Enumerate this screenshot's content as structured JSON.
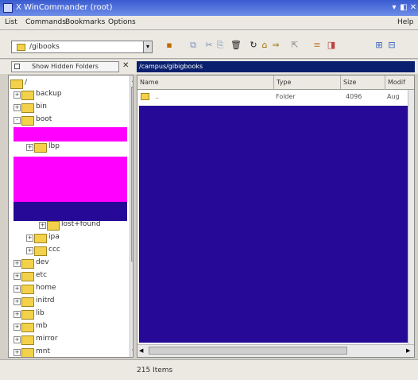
{
  "window": {
    "title": "X WinCommander (root)",
    "help": "Help",
    "controls": [
      "▾",
      "◧",
      "✕"
    ]
  },
  "menubar": {
    "items": [
      "List",
      "Commands",
      "Bookmarks",
      "Options"
    ]
  },
  "toolbar": {
    "path_combo": "/gibooks",
    "combo_arrow": "▾",
    "icons": [
      "▪",
      "⧉",
      "✂",
      "⎘",
      "🗑",
      "↻",
      "⌂",
      "⇒",
      "⇱",
      "≡",
      "◨",
      "⊞",
      "⊟"
    ]
  },
  "tree": {
    "show_hidden_label": "Show Hidden Folders",
    "close": "✕",
    "items": [
      {
        "label": "/",
        "indent": 0,
        "expander": ""
      },
      {
        "label": "backup",
        "indent": 1,
        "expander": "+"
      },
      {
        "label": "bin",
        "indent": 1,
        "expander": "+"
      },
      {
        "label": "boot",
        "indent": 1,
        "expander": "-"
      },
      {
        "label": "",
        "indent": 2,
        "expander": ""
      },
      {
        "label": "lbp",
        "indent": 2,
        "expander": "+"
      },
      {
        "label": "lost+found",
        "indent": 3,
        "expander": "+"
      },
      {
        "label": "ipa",
        "indent": 2,
        "expander": "+"
      },
      {
        "label": "ccc",
        "indent": 2,
        "expander": "+"
      },
      {
        "label": "dev",
        "indent": 1,
        "expander": "+"
      },
      {
        "label": "etc",
        "indent": 1,
        "expander": "+"
      },
      {
        "label": "home",
        "indent": 1,
        "expander": "+"
      },
      {
        "label": "initrd",
        "indent": 1,
        "expander": "+"
      },
      {
        "label": "lib",
        "indent": 1,
        "expander": "+"
      },
      {
        "label": "mb",
        "indent": 1,
        "expander": "+"
      },
      {
        "label": "mirror",
        "indent": 1,
        "expander": "+"
      },
      {
        "label": "mnt",
        "indent": 1,
        "expander": "+"
      }
    ]
  },
  "pathbar": {
    "text": "/campus/gibigbooks"
  },
  "list": {
    "columns": [
      "Name",
      "Type",
      "Size",
      "Modif"
    ],
    "rows": [
      {
        "name": "..",
        "type": "Folder",
        "size": "4096",
        "modified": "Aug"
      }
    ]
  },
  "status": {
    "text": "215 Items"
  },
  "colors": {
    "title_bar": "#3a5bd0",
    "path_bar": "#0a1f6e",
    "content_block": "#260996",
    "highlight": "#ff00ff"
  }
}
